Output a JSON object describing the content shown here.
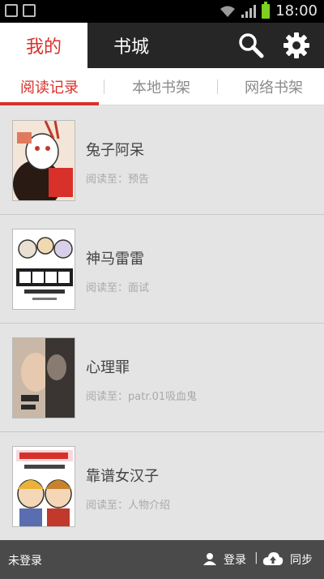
{
  "status_bar": {
    "time": "18:00"
  },
  "top_nav": {
    "tabs": [
      {
        "label": "我的",
        "active": true
      },
      {
        "label": "书城",
        "active": false
      }
    ],
    "icons": [
      "search-icon",
      "gear-icon"
    ]
  },
  "sub_tabs": [
    {
      "label": "阅读记录",
      "active": true
    },
    {
      "label": "本地书架",
      "active": false
    },
    {
      "label": "网络书架",
      "active": false
    }
  ],
  "list": [
    {
      "title": "兔子阿呆",
      "progress_label": "阅读至：",
      "progress_value": "预告",
      "cover_text": "兔子阿呆"
    },
    {
      "title": "神马雷雷",
      "progress_label": "阅读至：",
      "progress_value": "面试",
      "cover_text": "神马雷雷"
    },
    {
      "title": "心理罪",
      "progress_label": "阅读至：",
      "progress_value": "patr.01吸血鬼",
      "cover_text": "心理罪"
    },
    {
      "title": "靠谱女汉子",
      "progress_label": "阅读至：",
      "progress_value": "人物介绍",
      "cover_text": "靠谱女汉子"
    }
  ],
  "bottom_bar": {
    "status": "未登录",
    "login": "登录",
    "separator": "|",
    "sync": "同步"
  },
  "colors": {
    "accent": "#d8312a",
    "nav_bg": "#262626",
    "list_bg": "#e4e4e4",
    "bottom_bg": "#4a4a4a"
  }
}
